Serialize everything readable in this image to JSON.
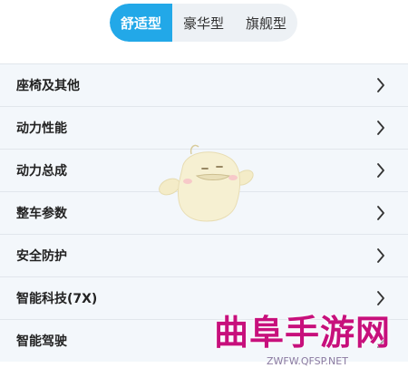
{
  "tabs": [
    {
      "label": "舒适型",
      "active": true
    },
    {
      "label": "豪华型",
      "active": false
    },
    {
      "label": "旗舰型",
      "active": false
    }
  ],
  "sections": [
    {
      "label": "座椅及其他"
    },
    {
      "label": "动力性能"
    },
    {
      "label": "动力总成"
    },
    {
      "label": "整车参数"
    },
    {
      "label": "安全防护"
    },
    {
      "label": "智能科技(7X)"
    },
    {
      "label": "智能驾驶"
    }
  ],
  "icons": {
    "row_arrow": "chevron-right-icon",
    "mascot": "chick-mascot-icon"
  },
  "watermark": {
    "title": "曲阜手游网",
    "url": "ZWFW.QFSP.NET"
  },
  "colors": {
    "accent": "#22a8e8",
    "row_bg": "#f3f7fb",
    "divider": "#e1e6ec",
    "watermark": "#c7107c"
  }
}
